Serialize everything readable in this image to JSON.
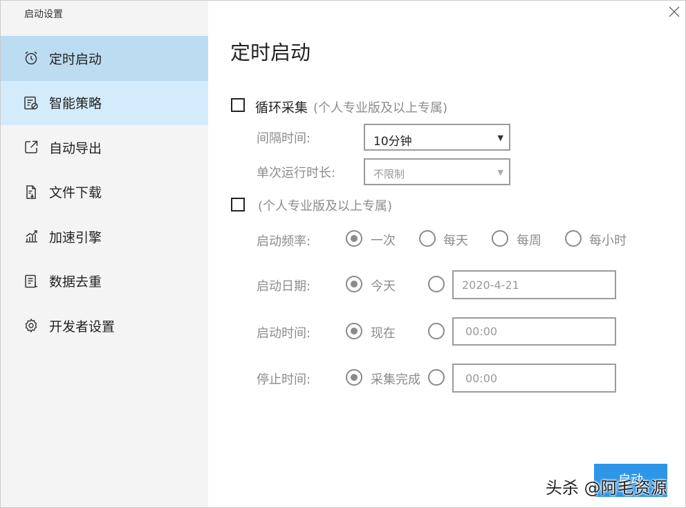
{
  "window": {
    "title": "启动设置"
  },
  "sidebar": {
    "items": [
      {
        "label": "定时启动",
        "icon": "alarm-clock-icon",
        "state": "active"
      },
      {
        "label": "智能策略",
        "icon": "strategy-icon",
        "state": "hover"
      },
      {
        "label": "自动导出",
        "icon": "export-icon",
        "state": "normal"
      },
      {
        "label": "文件下载",
        "icon": "file-download-icon",
        "state": "normal"
      },
      {
        "label": "加速引擎",
        "icon": "chart-growth-icon",
        "state": "normal"
      },
      {
        "label": "数据去重",
        "icon": "dedup-list-icon",
        "state": "normal"
      },
      {
        "label": "开发者设置",
        "icon": "gear-icon",
        "state": "normal"
      }
    ]
  },
  "main": {
    "title": "定时启动",
    "loop_collect": {
      "label": "循环采集",
      "note": "(个人专业版及以上专属)",
      "checked": false,
      "interval": {
        "label": "间隔时间:",
        "value": "10分钟"
      },
      "run_duration": {
        "label": "单次运行时长:",
        "value": "不限制"
      }
    },
    "schedule": {
      "note": "(个人专业版及以上专属)",
      "checked": false,
      "frequency": {
        "label": "启动频率:",
        "options": [
          "一次",
          "每天",
          "每周",
          "每小时"
        ],
        "selected": "一次"
      },
      "start_date": {
        "label": "启动日期:",
        "option_today": "今天",
        "selected": "今天",
        "input_value": "2020-4-21"
      },
      "start_time": {
        "label": "启动时间:",
        "option_now": "现在",
        "selected": "现在",
        "input_value": "00:00"
      },
      "stop_time": {
        "label": "停止时间:",
        "option_done": "采集完成",
        "selected": "采集完成",
        "input_value": "00:00"
      }
    },
    "start_button": "启动"
  },
  "watermark": "头杀 @阿毛资源",
  "colors": {
    "active_nav": "#bcdcf2",
    "hover_nav": "#d3ebfa",
    "sidebar_bg": "#f4f4f4",
    "primary_button": "#2e96e8"
  }
}
